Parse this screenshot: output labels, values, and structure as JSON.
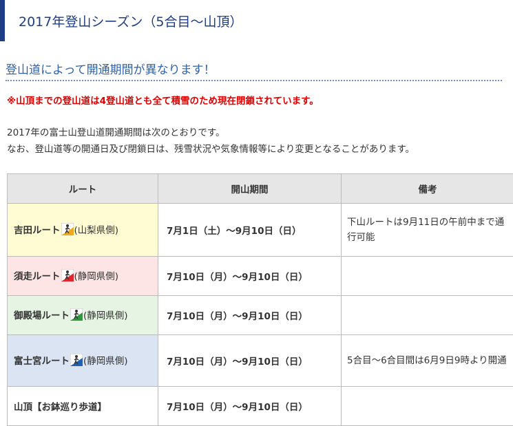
{
  "section_title": "2017年登山シーズン（5合目～山頂）",
  "subtitle": "登山道によって開通期間が異なります！",
  "warning": "※山頂までの登山道は4登山道とも全て積雪のため現在閉鎖されています。",
  "paragraphs": [
    "2017年の富士山登山道開通期間は次のとおりです。",
    "なお、登山道等の開通日及び閉鎖日は、残雪状況や気象情報等により変更となることがあります。"
  ],
  "table": {
    "headers": [
      "ルート",
      "開山期間",
      "備考"
    ],
    "rows": [
      {
        "route": "吉田ルート",
        "icon": "yellow-route-icon",
        "icon_color": "#f2a81d",
        "pref": "(山梨県側)",
        "period": "7月1日（土）～9月10日（日）",
        "note": "下山ルートは9月11日の午前中まで通行可能"
      },
      {
        "route": "須走ルート",
        "icon": "red-route-icon",
        "icon_color": "#e0262d",
        "pref": "(静岡県側)",
        "period": "7月10日（月）～9月10日（日）",
        "note": ""
      },
      {
        "route": "御殿場ルート",
        "icon": "green-route-icon",
        "icon_color": "#2b9a3a",
        "pref": "(静岡県側)",
        "period": "7月10日（月）～9月10日（日）",
        "note": ""
      },
      {
        "route": "富士宮ルート",
        "icon": "blue-route-icon",
        "icon_color": "#1e62b8",
        "pref": "(静岡県側)",
        "period": "7月10日（月）～9月10日（日）",
        "note": "5合目～6合目間は6月9日9時より開通"
      },
      {
        "route": "山頂【お鉢巡り歩道】",
        "icon": "",
        "pref": "",
        "period": "7月10日（月）～9月10日（日）",
        "note": ""
      }
    ]
  }
}
